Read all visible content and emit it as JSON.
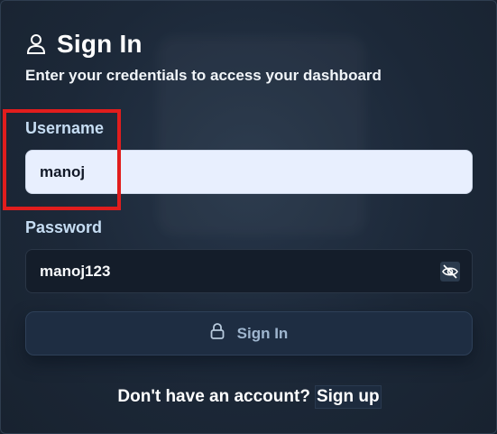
{
  "card": {
    "title": "Sign In",
    "subtitle": "Enter your credentials to access your dashboard"
  },
  "username": {
    "label": "Username",
    "value": "manoj"
  },
  "password": {
    "label": "Password",
    "value": "manoj123",
    "visibility_icon": "eye-off-icon"
  },
  "submit": {
    "label": "Sign In",
    "icon": "lock-icon"
  },
  "footer": {
    "prompt": "Don't have an account?",
    "link": "Sign up"
  },
  "colors": {
    "background": "#1c2838",
    "input_focus_bg": "#e8effe",
    "highlight": "#e11d1d"
  }
}
